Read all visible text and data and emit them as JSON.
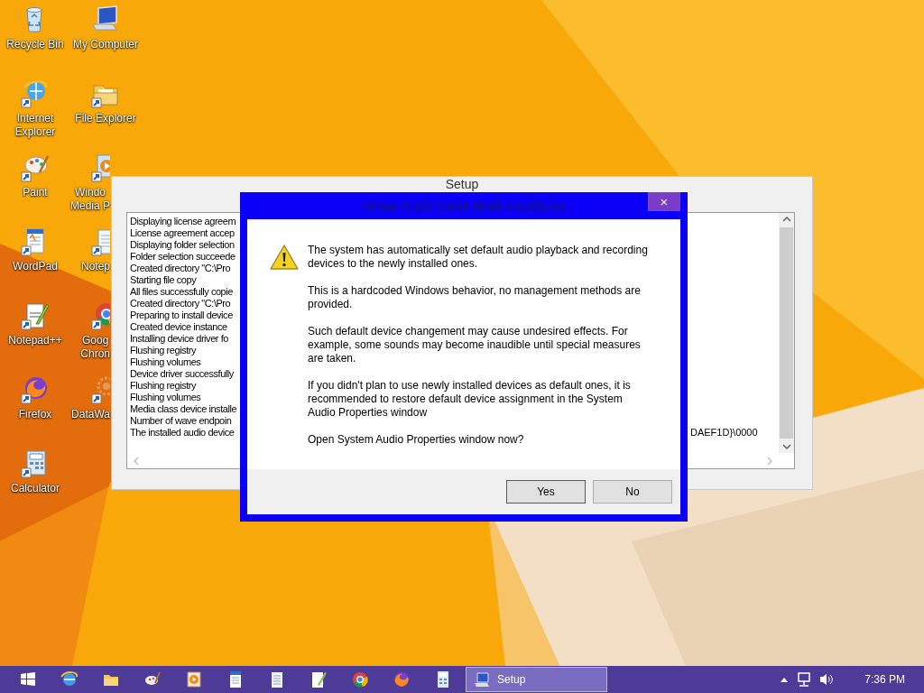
{
  "desktop": {
    "icons": [
      {
        "lines": [
          "Recycle Bin"
        ]
      },
      {
        "lines": [
          "My Computer"
        ]
      },
      {
        "lines": [
          "Internet",
          "Explorer"
        ]
      },
      {
        "lines": [
          "File Explorer"
        ]
      },
      {
        "lines": [
          "Paint"
        ]
      },
      {
        "lines": [
          "Windo",
          "Media P"
        ]
      },
      {
        "lines": [
          "WordPad"
        ]
      },
      {
        "lines": [
          "Notep"
        ]
      },
      {
        "lines": [
          "Notepad++"
        ]
      },
      {
        "lines": [
          "Goog",
          "Chron"
        ]
      },
      {
        "lines": [
          "Firefox"
        ]
      },
      {
        "lines": [
          "DataWa"
        ]
      },
      {
        "lines": [
          "Calculator"
        ]
      }
    ]
  },
  "setup_window": {
    "title": "Setup",
    "log_lines": [
      "Displaying license agreem",
      "License agreement accep",
      "Displaying folder selection",
      "Folder selection succeede",
      "Created directory \"C:\\Pro",
      "Starting file copy",
      "All files successfully copie",
      "Created directory \"C:\\Pro",
      "Preparing to install device",
      "Created device instance",
      "Installing device driver fo",
      "Flushing registry",
      "Flushing volumes",
      "Device driver successfully",
      "Flushing registry",
      "Flushing volumes",
      "Media class device installe",
      "Number of wave endpoin",
      "The installed audio device"
    ],
    "log_tail": "DAEF1D}\\0000"
  },
  "dialog": {
    "title": "Virtual Audio Cable (trial) installation",
    "close": "×",
    "paragraphs": [
      "The system has automatically set default audio playback and recording devices to the newly installed ones.",
      "This is a hardcoded Windows behavior, no management methods are provided.",
      "Such default device changement may cause undesired effects. For example, some sounds may become inaudible until special measures are taken.",
      "If you didn't plan to use newly installed devices as default ones, it is recommended to restore default device assignment in the System Audio Properties window",
      "Open System Audio Properties window now?"
    ],
    "buttons": [
      {
        "label": "Yes",
        "focused": true
      },
      {
        "label": "No",
        "focused": false
      }
    ]
  },
  "taskbar": {
    "window_button": {
      "label": "Setup",
      "selected": true
    },
    "clock": "7:36 PM"
  }
}
